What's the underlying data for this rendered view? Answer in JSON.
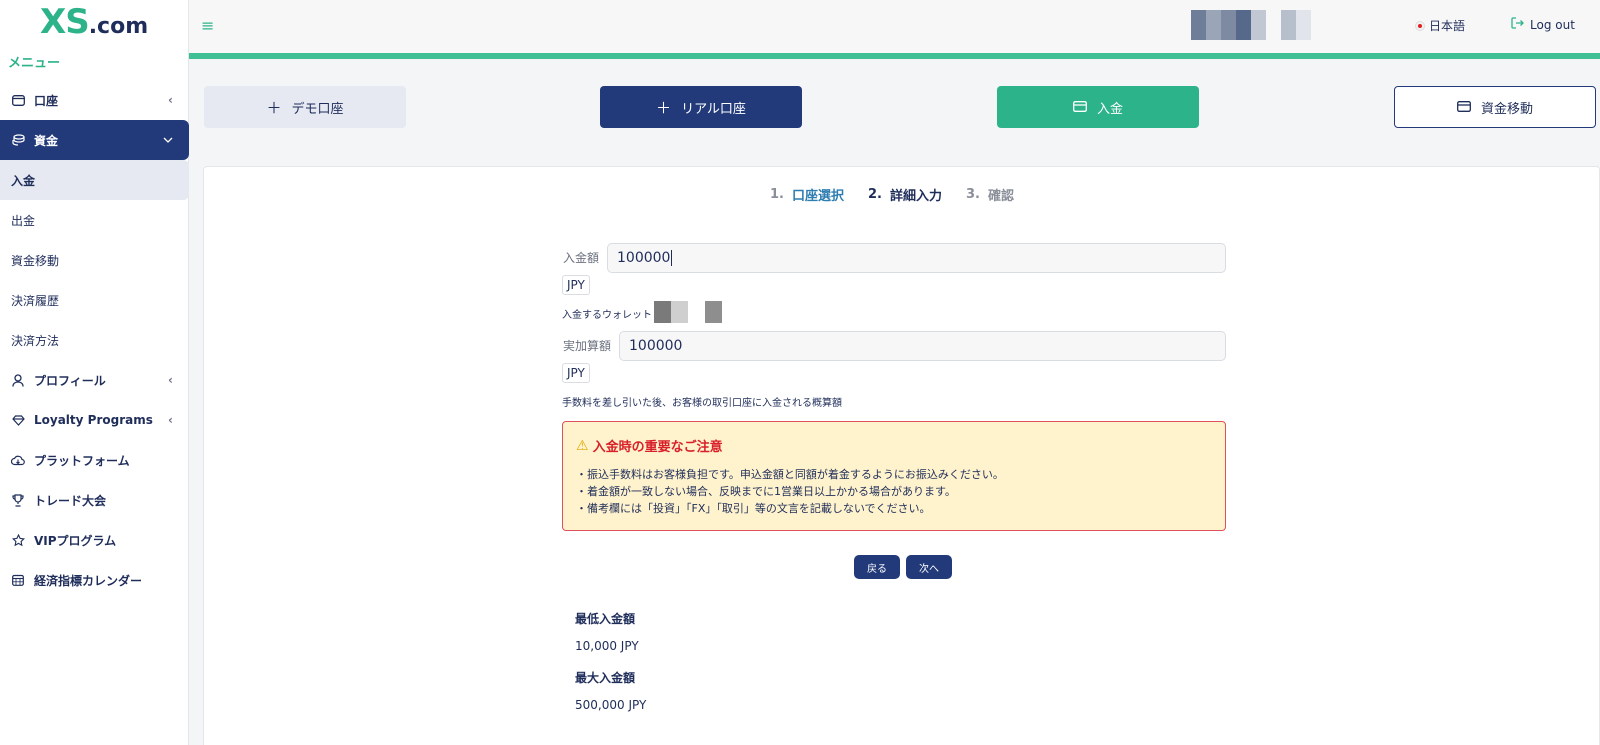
{
  "brand": {
    "logo_main": "XS",
    "logo_suffix": ".com"
  },
  "sidebar": {
    "menu_title": "メニュー",
    "items": [
      {
        "label": "口座",
        "icon": "wallet-icon",
        "chevron": "‹"
      },
      {
        "label": "資金",
        "icon": "coins-icon",
        "chevron": "⌄",
        "active": true
      },
      {
        "label": "入金",
        "sub": true,
        "current": true
      },
      {
        "label": "出金",
        "sub": true
      },
      {
        "label": "資金移動",
        "sub": true
      },
      {
        "label": "決済履歴",
        "sub": true
      },
      {
        "label": "決済方法",
        "sub": true
      },
      {
        "label": "プロフィール",
        "icon": "user-icon",
        "chevron": "‹"
      },
      {
        "label": "Loyalty Programs",
        "icon": "diamond-icon",
        "chevron": "‹"
      },
      {
        "label": "プラットフォーム",
        "icon": "cloud-download-icon"
      },
      {
        "label": "トレード大会",
        "icon": "trophy-icon"
      },
      {
        "label": "VIPプログラム",
        "icon": "star-icon"
      },
      {
        "label": "経済指標カレンダー",
        "icon": "calendar-icon"
      }
    ]
  },
  "header": {
    "language": "日本語",
    "logout": "Log out"
  },
  "actions": {
    "demo": "デモ口座",
    "real": "リアル口座",
    "deposit": "入金",
    "transfer": "資金移動"
  },
  "steps": [
    {
      "num": "1.",
      "label": "口座選択"
    },
    {
      "num": "2.",
      "label": "詳細入力"
    },
    {
      "num": "3.",
      "label": "確認"
    }
  ],
  "form": {
    "amount_label": "入金額",
    "amount_value": "100000",
    "amount_currency": "JPY",
    "wallet_label": "入金するウォレット",
    "credited_label": "実加算額",
    "credited_value": "100000",
    "credited_currency": "JPY",
    "credited_note": "手数料を差し引いた後、お客様の取引口座に入金される概算額"
  },
  "notice": {
    "title": "入金時の重要なご注意",
    "lines": [
      "・振込手数料はお客様負担です。申込金額と同額が着金するようにお振込みください。",
      "・着金額が一致しない場合、反映までに1営業日以上かかる場合があります。",
      "・備考欄には「投資」「FX」「取引」等の文言を記載しないでください。"
    ]
  },
  "buttons": {
    "back": "戻る",
    "next": "次へ"
  },
  "limits": {
    "min_label": "最低入金額",
    "min_value": "10,000 JPY",
    "max_label": "最大入金額",
    "max_value": "500,000 JPY"
  },
  "colors": {
    "brand_green": "#2db38a",
    "navy": "#223a7a",
    "warning_red": "#d8202a",
    "warning_bg": "#fff3cd"
  }
}
